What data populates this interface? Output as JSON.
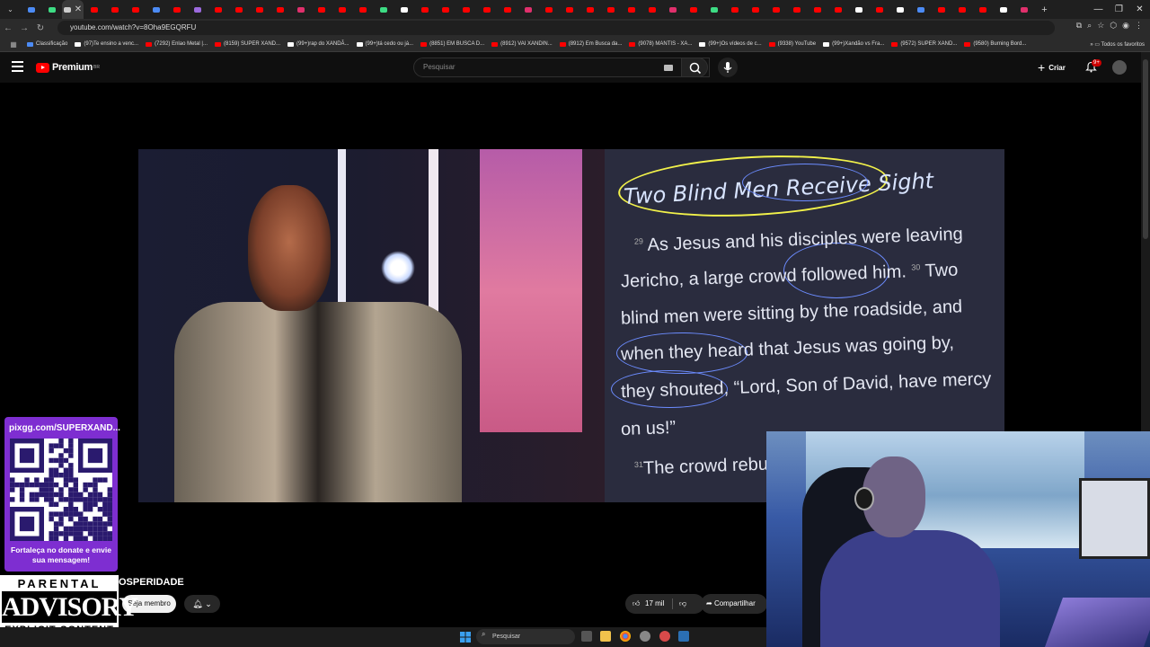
{
  "browser": {
    "tab_favicon_colors": [
      "#4c8bf5",
      "#3ddc84",
      "#cccccc",
      "#ff0000",
      "#ff0000",
      "#ff0000",
      "#4c8bf5",
      "#ff0000",
      "#9c6ade",
      "#ff0000",
      "#ff0000",
      "#ff0000",
      "#ff0000",
      "#e1306c",
      "#ff0000",
      "#ff0000",
      "#ff0000",
      "#3ddc84",
      "#ffffff",
      "#ff0000",
      "#ff0000",
      "#ff0000",
      "#ff0000",
      "#ff0000",
      "#e1306c",
      "#ff0000",
      "#ff0000",
      "#ff0000",
      "#ff0000",
      "#ff0000",
      "#ff0000",
      "#e1306c",
      "#ff0000",
      "#3ddc84",
      "#ff0000",
      "#ff0000",
      "#ff0000",
      "#ff0000",
      "#ff0000",
      "#ff0000",
      "#ffffff",
      "#ff0000",
      "#ffffff",
      "#4c8bf5",
      "#ff0000",
      "#ff0000",
      "#ff0000",
      "#ffffff",
      "#e1306c"
    ],
    "new_tab": "+",
    "url": "youtube.com/watch?v=8Oha9EGQRFU",
    "bookmarks": [
      {
        "label": "Classificação",
        "color": "#4c8bf5"
      },
      {
        "label": "(97)Te ensino a venc...",
        "color": "#ffffff"
      },
      {
        "label": "(7292) Enlao Metal |...",
        "color": "#ff0000"
      },
      {
        "label": "(8159) SUPER XAND...",
        "color": "#ff0000"
      },
      {
        "label": "(99+)rap do XANDÃ...",
        "color": "#ffffff"
      },
      {
        "label": "(99+)tá cedo ou já...",
        "color": "#ffffff"
      },
      {
        "label": "(8851) EM BUSCA D...",
        "color": "#ff0000"
      },
      {
        "label": "(8912) VAI XANDIN...",
        "color": "#ff0000"
      },
      {
        "label": "(8912) Em Busca da...",
        "color": "#ff0000"
      },
      {
        "label": "(9078) MANTIS - XA...",
        "color": "#ff0000"
      },
      {
        "label": "(99+)Os vídeos de c...",
        "color": "#ffffff"
      },
      {
        "label": "(9338) YouTube",
        "color": "#ff0000"
      },
      {
        "label": "(99+)Xandão vs Fra...",
        "color": "#ffffff"
      },
      {
        "label": "(9572) SUPER XAND...",
        "color": "#ff0000"
      },
      {
        "label": "(9580) Burning Bord...",
        "color": "#ff0000"
      }
    ],
    "all_bookmarks": "Todos os favoritos"
  },
  "youtube": {
    "logo_text": "Premium",
    "logo_region": "BR",
    "search_placeholder": "Pesquisar",
    "create_label": "Criar",
    "notification_badge": "9+",
    "video_title_fragment": "OSPERIDADE",
    "join_label": "Seja membro",
    "like_count": "17 mil",
    "share_label": "Compartilhar"
  },
  "video_frame": {
    "slide_title": "Two Blind Men Receive Sight",
    "lines": [
      {
        "num": "29",
        "text": "As Jesus and his disciples were leaving"
      },
      {
        "num": "",
        "text": "Jericho, a large crowd followed him."
      },
      {
        "num": "",
        "text": "blind men were sitting by the roadside, and"
      },
      {
        "num": "",
        "text": "when they heard that Jesus was going by,"
      },
      {
        "num": "",
        "text": "they shouted, “Lord, Son of David, have mercy"
      },
      {
        "num": "",
        "text": "on us!”"
      },
      {
        "num": "31",
        "text": "The crowd rebuk"
      }
    ],
    "inline_verse": "30",
    "inline_text": "Two"
  },
  "overlay": {
    "qr_url": "pixgg.com/SUPERXAND...",
    "qr_caption": "Fortaleça no donate e envie sua mensagem!",
    "advisory_top": "PARENTAL",
    "advisory_mid": "ADVISORY",
    "advisory_bottom": "EXPLICIT CONTENT"
  },
  "taskbar": {
    "search_label": "Pesquisar"
  }
}
